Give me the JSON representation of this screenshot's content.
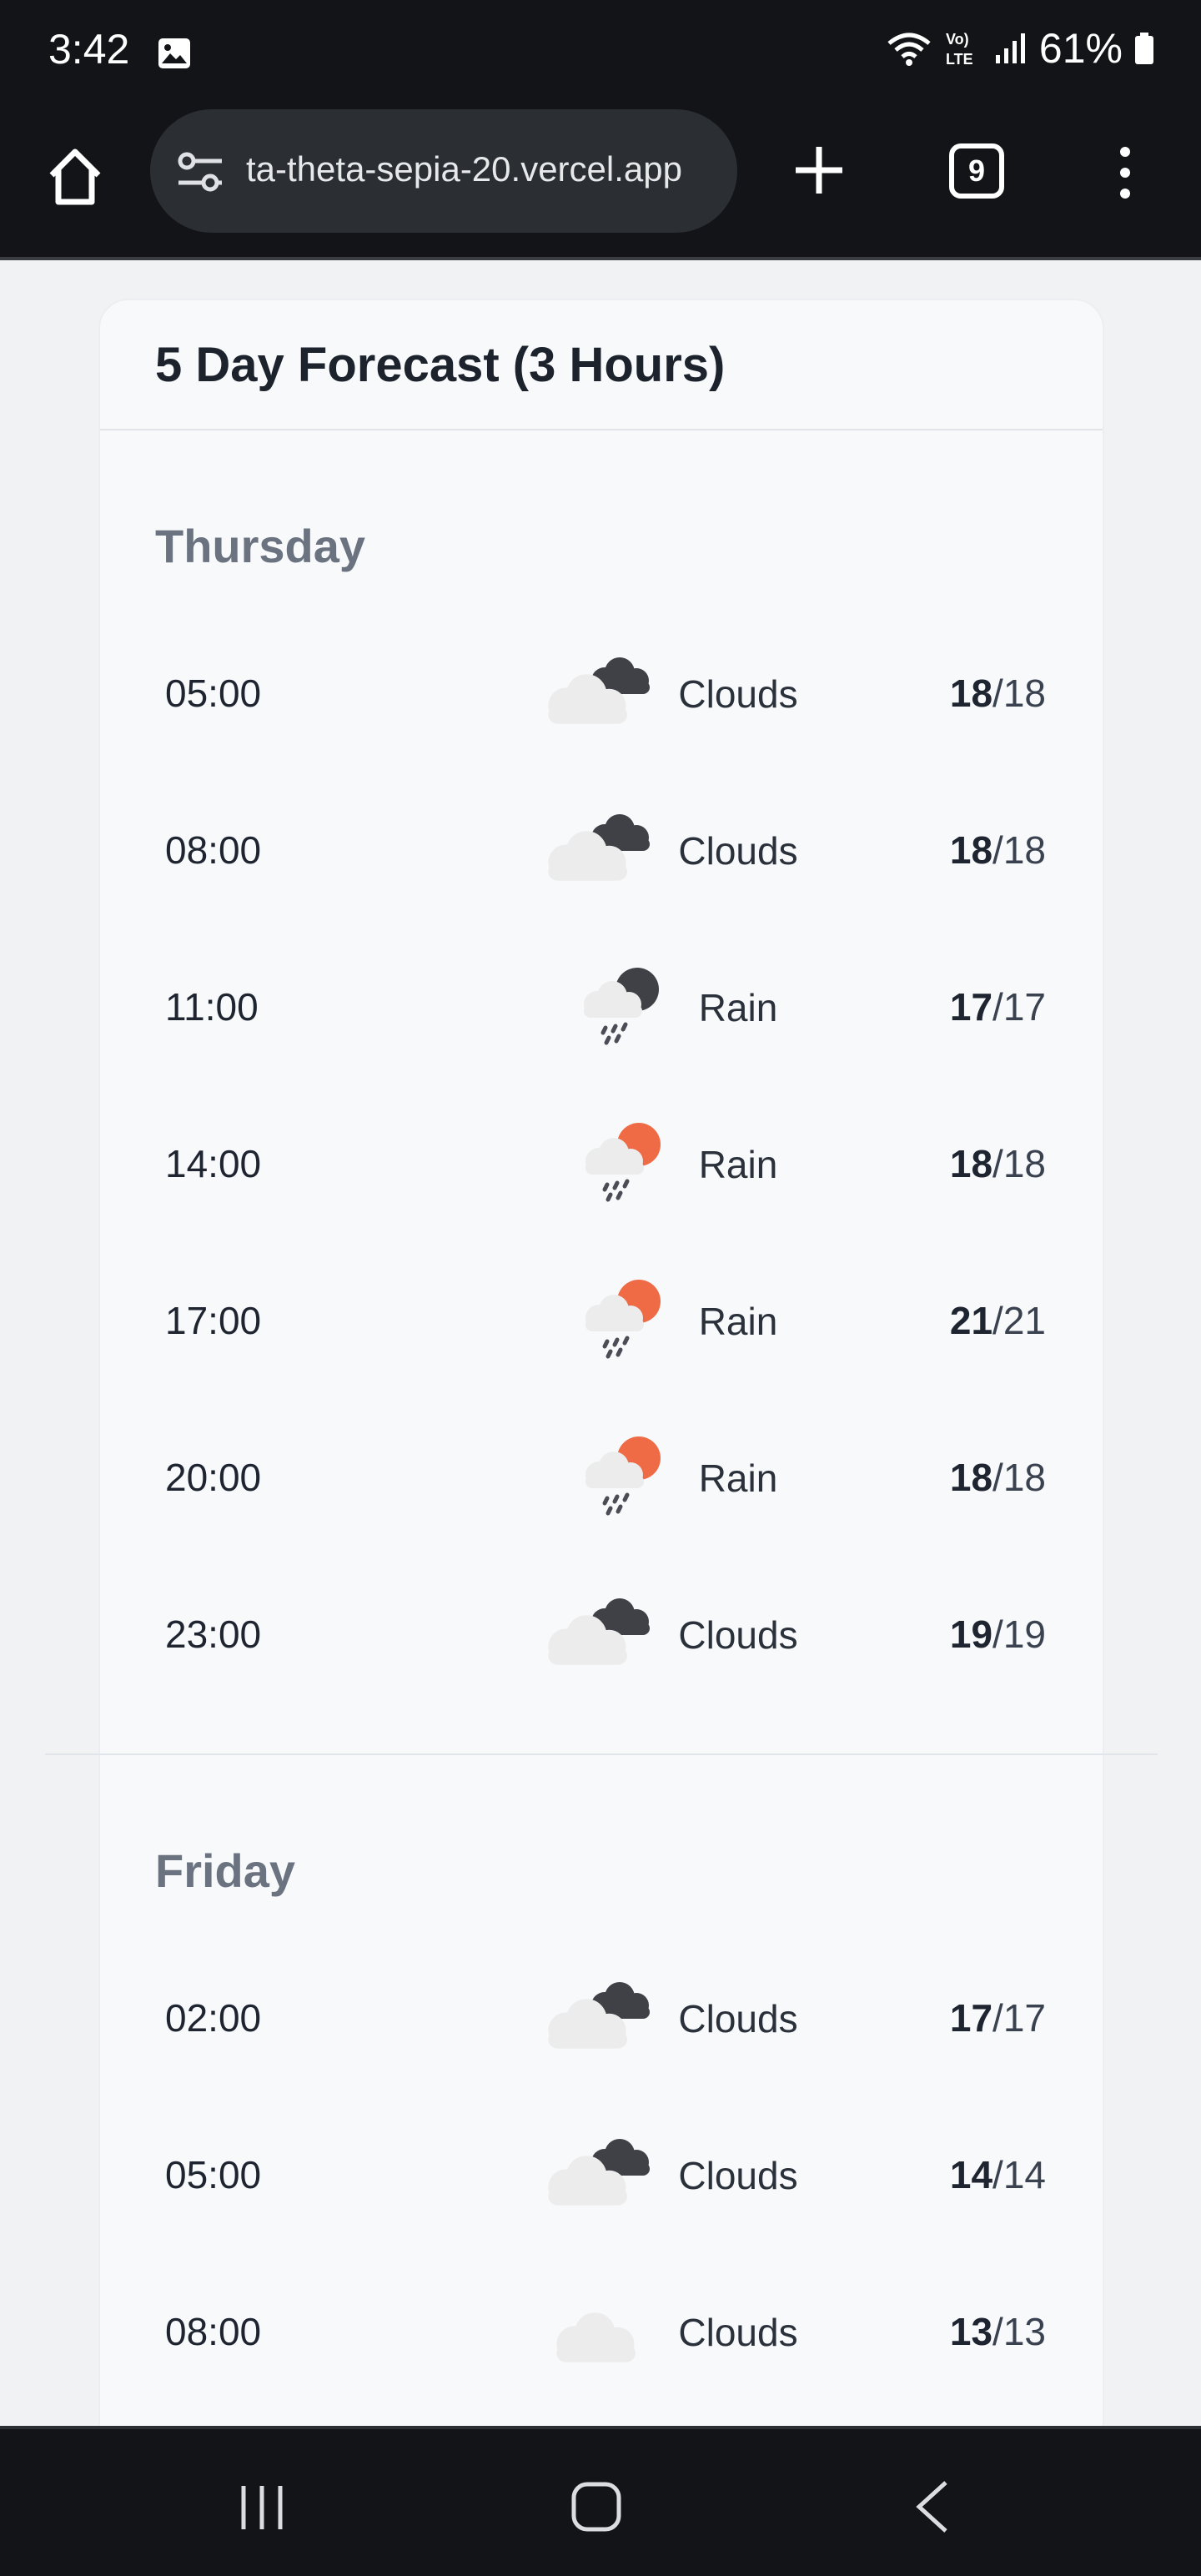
{
  "status": {
    "time": "3:42",
    "battery": "61%",
    "network": "VoLTE"
  },
  "browser": {
    "url": "ta-theta-sepia-20.vercel.app",
    "tab_count": "9"
  },
  "card": {
    "title": "5 Day Forecast (3 Hours)"
  },
  "days": [
    {
      "name": "Thursday",
      "rows": [
        {
          "time": "05:00",
          "icon": "dark-cloud-icon",
          "desc": "Clouds",
          "hi": "18",
          "lo": "/18"
        },
        {
          "time": "08:00",
          "icon": "dark-cloud-icon",
          "desc": "Clouds",
          "hi": "18",
          "lo": "/18"
        },
        {
          "time": "11:00",
          "icon": "night-rain-icon",
          "desc": "Rain",
          "hi": "17",
          "lo": "/17"
        },
        {
          "time": "14:00",
          "icon": "sun-rain-icon",
          "desc": "Rain",
          "hi": "18",
          "lo": "/18"
        },
        {
          "time": "17:00",
          "icon": "sun-rain-icon",
          "desc": "Rain",
          "hi": "21",
          "lo": "/21"
        },
        {
          "time": "20:00",
          "icon": "sun-rain-icon",
          "desc": "Rain",
          "hi": "18",
          "lo": "/18"
        },
        {
          "time": "23:00",
          "icon": "dark-cloud-icon",
          "desc": "Clouds",
          "hi": "19",
          "lo": "/19"
        }
      ]
    },
    {
      "name": "Friday",
      "rows": [
        {
          "time": "02:00",
          "icon": "dark-cloud-icon",
          "desc": "Clouds",
          "hi": "17",
          "lo": "/17"
        },
        {
          "time": "05:00",
          "icon": "dark-cloud-icon",
          "desc": "Clouds",
          "hi": "14",
          "lo": "/14"
        },
        {
          "time": "08:00",
          "icon": "light-cloud-icon",
          "desc": "Clouds",
          "hi": "13",
          "lo": "/13"
        }
      ]
    }
  ],
  "colors": {
    "sun": "#ee6b45",
    "cloud_dark": "#3f4147",
    "cloud_light": "#ececec",
    "rain": "#4a4d55"
  }
}
